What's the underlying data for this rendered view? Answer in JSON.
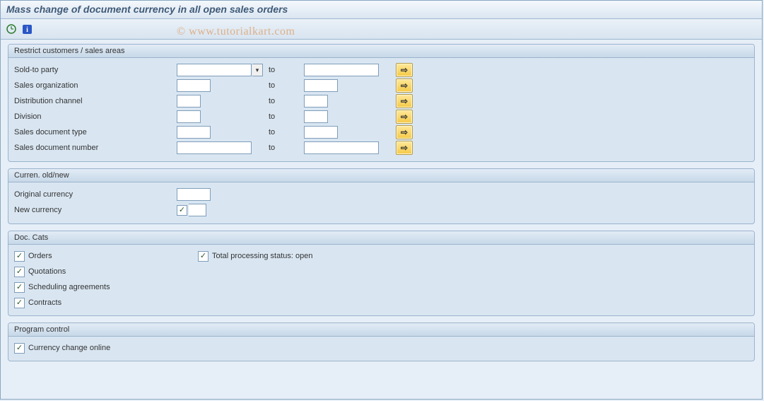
{
  "title": "Mass change of document currency in all open sales orders",
  "watermark": "© www.tutorialkart.com",
  "groups": {
    "restrict": {
      "title": "Restrict customers / sales areas",
      "to_label": "to",
      "rows": {
        "sold_to": "Sold-to party",
        "sales_org": "Sales organization",
        "dist_ch": "Distribution channel",
        "division": "Division",
        "doc_type": "Sales document type",
        "doc_num": "Sales document number"
      }
    },
    "curren": {
      "title": "Curren. old/new",
      "orig": "Original currency",
      "new": "New currency"
    },
    "doccats": {
      "title": "Doc. Cats",
      "orders": "Orders",
      "quotations": "Quotations",
      "sched": "Scheduling agreements",
      "contracts": "Contracts",
      "total_open": "Total processing status: open"
    },
    "progctrl": {
      "title": "Program control",
      "online": "Currency change online"
    }
  },
  "values": {
    "sold_to_from": "",
    "sold_to_to": "",
    "sales_org_from": "",
    "sales_org_to": "",
    "dist_ch_from": "",
    "dist_ch_to": "",
    "division_from": "",
    "division_to": "",
    "doc_type_from": "",
    "doc_type_to": "",
    "doc_num_from": "",
    "doc_num_to": "",
    "orig_curr": "",
    "new_curr": ""
  },
  "checks": {
    "orders": true,
    "quotations": true,
    "sched": true,
    "contracts": true,
    "total_open": true,
    "online": true,
    "new_curr_req": true
  }
}
